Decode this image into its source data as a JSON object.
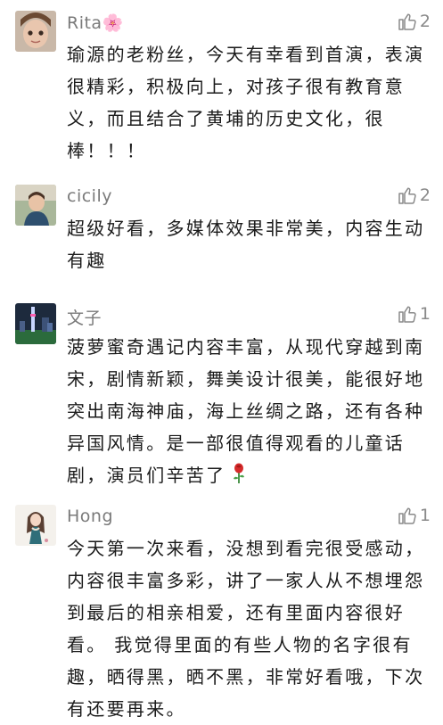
{
  "comments": [
    {
      "name": "Rita🌸",
      "likes": "2",
      "text": "瑜源的老粉丝，今天有幸看到首演，表演很精彩，积极向上，对孩子很有教育意义，而且结合了黄埔的历史文化，很棒！！！",
      "avatar_icon": "girl-photo-avatar"
    },
    {
      "name": "cicily",
      "likes": "2",
      "text": "超级好看，多媒体效果非常美，内容生动有趣",
      "avatar_icon": "child-photo-avatar"
    },
    {
      "name": "文子",
      "likes": "1",
      "text": "菠萝蜜奇遇记内容丰富，从现代穿越到南宋，剧情新颖，舞美设计很美，能很好地突出南海神庙，海上丝绸之路，还有各种异国风情。是一部很值得观看的儿童话剧，演员们辛苦了",
      "text_emoji": "rose-icon",
      "avatar_icon": "night-city-avatar"
    },
    {
      "name": "Hong",
      "likes": "1",
      "text": "今天第一次来看，没想到看完很受感动，内容很丰富多彩，讲了一家人从不想埋怨到最后的相亲相爱，还有里面内容很好看。 我觉得里面的有些人物的名字很有趣，晒得黑，晒不黑，非常好看哦，下次有还要再来。",
      "avatar_icon": "illustrated-girl-avatar"
    }
  ],
  "colors": {
    "name": "#7a7a7a",
    "text": "#1b1b1b",
    "like": "#8a8a8a"
  }
}
